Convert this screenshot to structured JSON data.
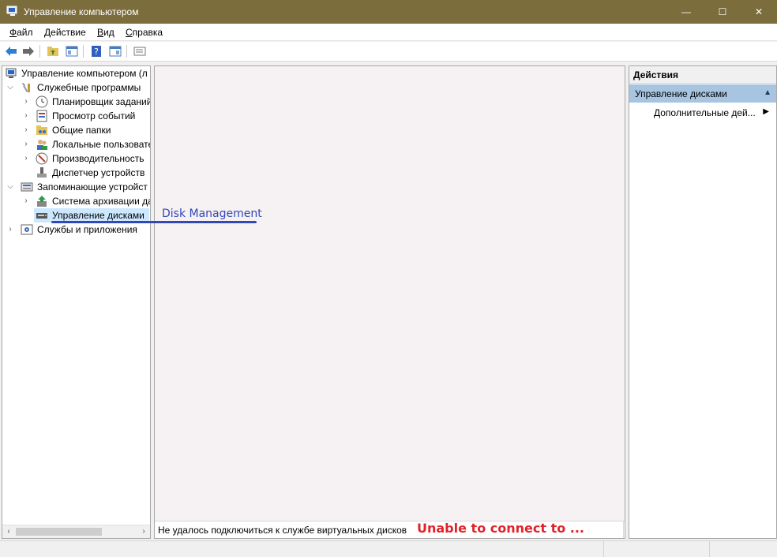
{
  "window": {
    "title": "Управление компьютером",
    "minimize_glyph": "—",
    "maximize_glyph": "☐",
    "close_glyph": "✕"
  },
  "menu": [
    {
      "key": "Ф",
      "rest": "айл"
    },
    {
      "key": "Д",
      "rest": "ействие"
    },
    {
      "key": "В",
      "rest": "ид"
    },
    {
      "key": "С",
      "rest": "правка"
    }
  ],
  "tree": {
    "root": "Управление компьютером (л",
    "utilities": "Служебные программы",
    "scheduler": "Планировщик заданий",
    "event_viewer": "Просмотр событий",
    "shared_folders": "Общие папки",
    "local_users": "Локальные пользовате",
    "performance": "Производительность",
    "device_manager": "Диспетчер устройств",
    "storage": "Запоминающие устройст",
    "backup": "Система архивации да",
    "disk_mgmt": "Управление дисками",
    "services": "Службы и приложения"
  },
  "main": {
    "status_message": "Не удалось подключиться к службе виртуальных дисков"
  },
  "actions": {
    "header": "Действия",
    "group": "Управление дисками",
    "more": "Дополнительные дей..."
  },
  "annotations": {
    "disk_management": "Disk Management",
    "unable": "Unable to connect to ..."
  },
  "colors": {
    "titlebar": "#7c6d3c",
    "annotation_blue": "#3347b8",
    "annotation_red": "#e0222a",
    "selection": "#cce8ff",
    "action_group": "#a7c4e0"
  }
}
